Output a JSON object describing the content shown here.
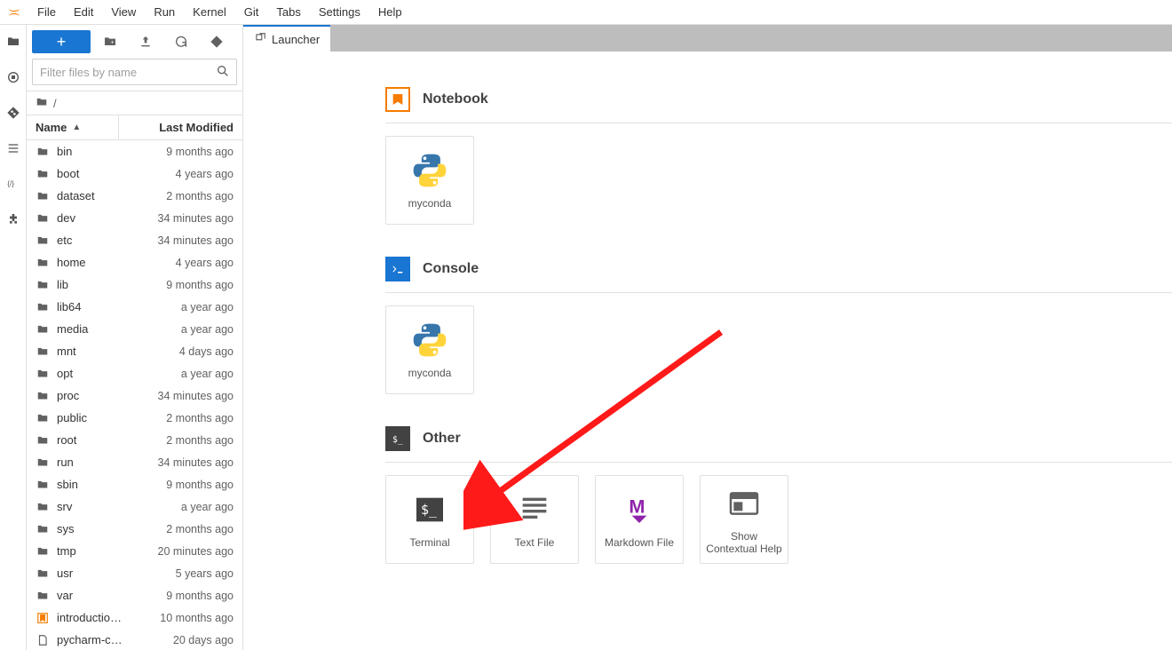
{
  "menu": [
    "File",
    "Edit",
    "View",
    "Run",
    "Kernel",
    "Git",
    "Tabs",
    "Settings",
    "Help"
  ],
  "filebrowser": {
    "filter_placeholder": "Filter files by name",
    "breadcrumb": "/",
    "columns": {
      "name": "Name",
      "modified": "Last Modified"
    },
    "files": [
      {
        "name": "bin",
        "type": "folder",
        "modified": "9 months ago"
      },
      {
        "name": "boot",
        "type": "folder",
        "modified": "4 years ago"
      },
      {
        "name": "dataset",
        "type": "folder",
        "modified": "2 months ago"
      },
      {
        "name": "dev",
        "type": "folder",
        "modified": "34 minutes ago"
      },
      {
        "name": "etc",
        "type": "folder",
        "modified": "34 minutes ago"
      },
      {
        "name": "home",
        "type": "folder",
        "modified": "4 years ago"
      },
      {
        "name": "lib",
        "type": "folder",
        "modified": "9 months ago"
      },
      {
        "name": "lib64",
        "type": "folder",
        "modified": "a year ago"
      },
      {
        "name": "media",
        "type": "folder",
        "modified": "a year ago"
      },
      {
        "name": "mnt",
        "type": "folder",
        "modified": "4 days ago"
      },
      {
        "name": "opt",
        "type": "folder",
        "modified": "a year ago"
      },
      {
        "name": "proc",
        "type": "folder",
        "modified": "34 minutes ago"
      },
      {
        "name": "public",
        "type": "folder",
        "modified": "2 months ago"
      },
      {
        "name": "root",
        "type": "folder",
        "modified": "2 months ago"
      },
      {
        "name": "run",
        "type": "folder",
        "modified": "34 minutes ago"
      },
      {
        "name": "sbin",
        "type": "folder",
        "modified": "9 months ago"
      },
      {
        "name": "srv",
        "type": "folder",
        "modified": "a year ago"
      },
      {
        "name": "sys",
        "type": "folder",
        "modified": "2 months ago"
      },
      {
        "name": "tmp",
        "type": "folder",
        "modified": "20 minutes ago"
      },
      {
        "name": "usr",
        "type": "folder",
        "modified": "5 years ago"
      },
      {
        "name": "var",
        "type": "folder",
        "modified": "9 months ago"
      },
      {
        "name": "introductio…",
        "type": "notebook",
        "modified": "10 months ago"
      },
      {
        "name": "pycharm-c…",
        "type": "file",
        "modified": "20 days ago"
      }
    ]
  },
  "tab": {
    "label": "Launcher"
  },
  "launcher": {
    "notebook": {
      "title": "Notebook",
      "cards": [
        {
          "label": "myconda",
          "icon": "python"
        }
      ]
    },
    "console": {
      "title": "Console",
      "cards": [
        {
          "label": "myconda",
          "icon": "python"
        }
      ]
    },
    "other": {
      "title": "Other",
      "cards": [
        {
          "label": "Terminal",
          "icon": "terminal"
        },
        {
          "label": "Text File",
          "icon": "textlines"
        },
        {
          "label": "Markdown File",
          "icon": "markdown"
        },
        {
          "label": "Show Contextual Help",
          "icon": "contextual"
        }
      ]
    }
  },
  "annotations": {
    "arrow": {
      "from": "top-right",
      "to": "Terminal card",
      "color": "#ff1a1a"
    }
  }
}
